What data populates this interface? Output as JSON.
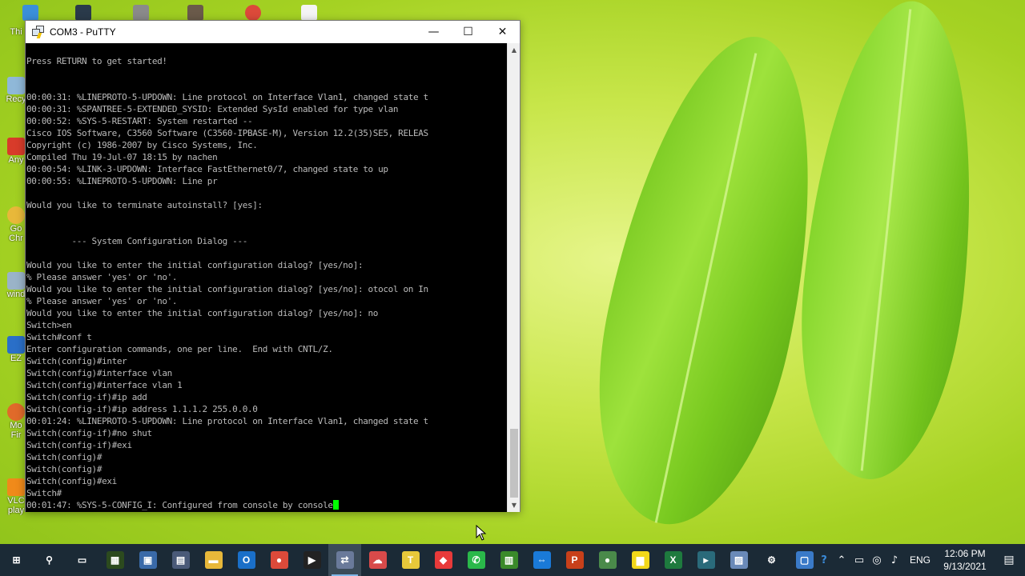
{
  "window": {
    "title": "COM3 - PuTTY",
    "minimize_glyph": "—",
    "maximize_glyph": "☐",
    "close_glyph": "✕"
  },
  "terminal": {
    "lines": [
      "",
      "Press RETURN to get started!",
      "",
      "",
      "00:00:31: %LINEPROTO-5-UPDOWN: Line protocol on Interface Vlan1, changed state t",
      "00:00:31: %SPANTREE-5-EXTENDED_SYSID: Extended SysId enabled for type vlan",
      "00:00:52: %SYS-5-RESTART: System restarted --",
      "Cisco IOS Software, C3560 Software (C3560-IPBASE-M), Version 12.2(35)SE5, RELEAS",
      "Copyright (c) 1986-2007 by Cisco Systems, Inc.",
      "Compiled Thu 19-Jul-07 18:15 by nachen",
      "00:00:54: %LINK-3-UPDOWN: Interface FastEthernet0/7, changed state to up",
      "00:00:55: %LINEPROTO-5-UPDOWN: Line pr",
      "",
      "Would you like to terminate autoinstall? [yes]:",
      "",
      "",
      "         --- System Configuration Dialog ---",
      "",
      "Would you like to enter the initial configuration dialog? [yes/no]:",
      "% Please answer 'yes' or 'no'.",
      "Would you like to enter the initial configuration dialog? [yes/no]: otocol on In",
      "% Please answer 'yes' or 'no'.",
      "Would you like to enter the initial configuration dialog? [yes/no]: no",
      "Switch>en",
      "Switch#conf t",
      "Enter configuration commands, one per line.  End with CNTL/Z.",
      "Switch(config)#inter",
      "Switch(config)#interface vlan",
      "Switch(config)#interface vlan 1",
      "Switch(config-if)#ip add",
      "Switch(config-if)#ip address 1.1.1.2 255.0.0.0",
      "00:01:24: %LINEPROTO-5-UPDOWN: Line protocol on Interface Vlan1, changed state t",
      "Switch(config-if)#no shut",
      "Switch(config-if)#exi",
      "Switch(config)#",
      "Switch(config)#",
      "Switch(config)#exi",
      "Switch#",
      "00:01:47: %SYS-5-CONFIG_I: Configured from console by console"
    ],
    "text_color": "#bbbbbb",
    "background": "#000000",
    "cursor_color": "#00ff00"
  },
  "desktop": {
    "icons": [
      {
        "label": "Thi",
        "color": "#3b8fd9",
        "icon": "this-pc-icon"
      },
      {
        "label": "Recy",
        "color": "#8fb8d8",
        "icon": "recycle-bin-icon"
      },
      {
        "label": "Any",
        "color": "#d83b2a",
        "icon": "anydesk-icon"
      },
      {
        "label": "Go",
        "color": "#e8b83a",
        "icon": "chrome-icon"
      },
      {
        "label": "Chr",
        "color": "#e8b83a",
        "icon": "chrome-label"
      },
      {
        "label": "wind",
        "color": "#9ab3c8",
        "icon": "windows-file-icon"
      },
      {
        "label": "EZ",
        "color": "#2a6fc8",
        "icon": "ez-icon"
      },
      {
        "label": "Mo",
        "color": "#e06a2a",
        "icon": "firefox-icon"
      },
      {
        "label": "Fir",
        "color": "#e06a2a",
        "icon": "firefox-label"
      },
      {
        "label": "VLC",
        "color": "#f08a1a",
        "icon": "vlc-icon"
      },
      {
        "label": "play",
        "color": "#f08a1a",
        "icon": "vlc-label"
      }
    ]
  },
  "taskbar": {
    "items": [
      {
        "name": "start",
        "glyph": "⊞",
        "color": "transparent"
      },
      {
        "name": "search",
        "glyph": "⚲",
        "color": "transparent"
      },
      {
        "name": "task-view",
        "glyph": "▭",
        "color": "transparent"
      },
      {
        "name": "gns",
        "glyph": "▦",
        "color": "#2c4a1e"
      },
      {
        "name": "computer",
        "glyph": "▣",
        "color": "#3a6aa8"
      },
      {
        "name": "network",
        "glyph": "▤",
        "color": "#4a5a78"
      },
      {
        "name": "file-explorer",
        "glyph": "▬",
        "color": "#e8b83a"
      },
      {
        "name": "outlook",
        "glyph": "O",
        "color": "#1a6fc8"
      },
      {
        "name": "chrome",
        "glyph": "●",
        "color": "#dc4a3a"
      },
      {
        "name": "media",
        "glyph": "▶",
        "color": "#222222"
      },
      {
        "name": "putty",
        "glyph": "⇄",
        "color": "#6a7a9a"
      },
      {
        "name": "app-cloud",
        "glyph": "☁",
        "color": "#d84a4a"
      },
      {
        "name": "teamviewer-t",
        "glyph": "T",
        "color": "#e8c83a"
      },
      {
        "name": "anydesk",
        "glyph": "◆",
        "color": "#e83a3a"
      },
      {
        "name": "whatsapp",
        "glyph": "✆",
        "color": "#2ab84a"
      },
      {
        "name": "pcb",
        "glyph": "▥",
        "color": "#3a8a2a"
      },
      {
        "name": "teamviewer",
        "glyph": "⇔",
        "color": "#1a7ad8"
      },
      {
        "name": "powerpoint",
        "glyph": "P",
        "color": "#c8401a"
      },
      {
        "name": "chrome-2",
        "glyph": "●",
        "color": "#4a8a4a"
      },
      {
        "name": "sticky-notes",
        "glyph": "▆",
        "color": "#f2d81a"
      },
      {
        "name": "excel",
        "glyph": "X",
        "color": "#1e7a3e"
      },
      {
        "name": "app-arrow",
        "glyph": "▸",
        "color": "#2a6a7a"
      },
      {
        "name": "app-box",
        "glyph": "▨",
        "color": "#6a8ab8"
      },
      {
        "name": "settings",
        "glyph": "⚙",
        "color": "transparent"
      },
      {
        "name": "app-window",
        "glyph": "▢",
        "color": "#3a7ac8"
      }
    ],
    "active_index": 10,
    "tray": {
      "language": "ENG",
      "time": "12:06 PM",
      "date": "9/13/2021"
    }
  }
}
